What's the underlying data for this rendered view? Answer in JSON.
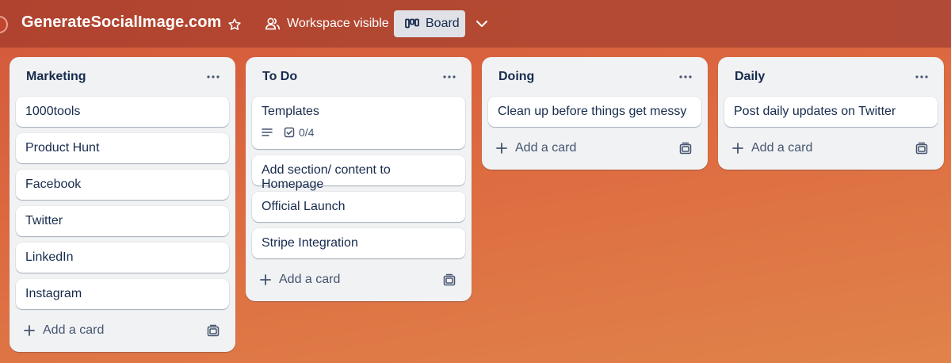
{
  "header": {
    "board_title": "GenerateSocialImage.com",
    "star_icon": "star-icon",
    "visibility_label": "Workspace visible",
    "visibility_icon": "people-icon",
    "view_label": "Board",
    "view_icon": "board-icon",
    "views_menu_icon": "chevron-down-icon"
  },
  "colors": {
    "background": "#dd6a40",
    "topbar": "#b0432f",
    "list_background": "#f1f2f4",
    "card_background": "#ffffff",
    "text_primary": "#172b4d",
    "text_subtle": "#44546f"
  },
  "lists": [
    {
      "title": "Marketing",
      "cards": [
        {
          "title": "1000tools"
        },
        {
          "title": "Product Hunt"
        },
        {
          "title": "Facebook"
        },
        {
          "title": "Twitter"
        },
        {
          "title": "LinkedIn"
        },
        {
          "title": "Instagram"
        }
      ],
      "add_card_label": "Add a card"
    },
    {
      "title": "To Do",
      "cards": [
        {
          "title": "Templates",
          "checklist": "0/4",
          "has_description": true
        },
        {
          "title": "Add section/ content to Homepage"
        },
        {
          "title": "Official Launch"
        },
        {
          "title": "Stripe Integration"
        }
      ],
      "add_card_label": "Add a card"
    },
    {
      "title": "Doing",
      "cards": [
        {
          "title": "Clean up before things get messy"
        }
      ],
      "add_card_label": "Add a card"
    },
    {
      "title": "Daily",
      "cards": [
        {
          "title": "Post daily updates on Twitter"
        }
      ],
      "add_card_label": "Add a card"
    }
  ]
}
